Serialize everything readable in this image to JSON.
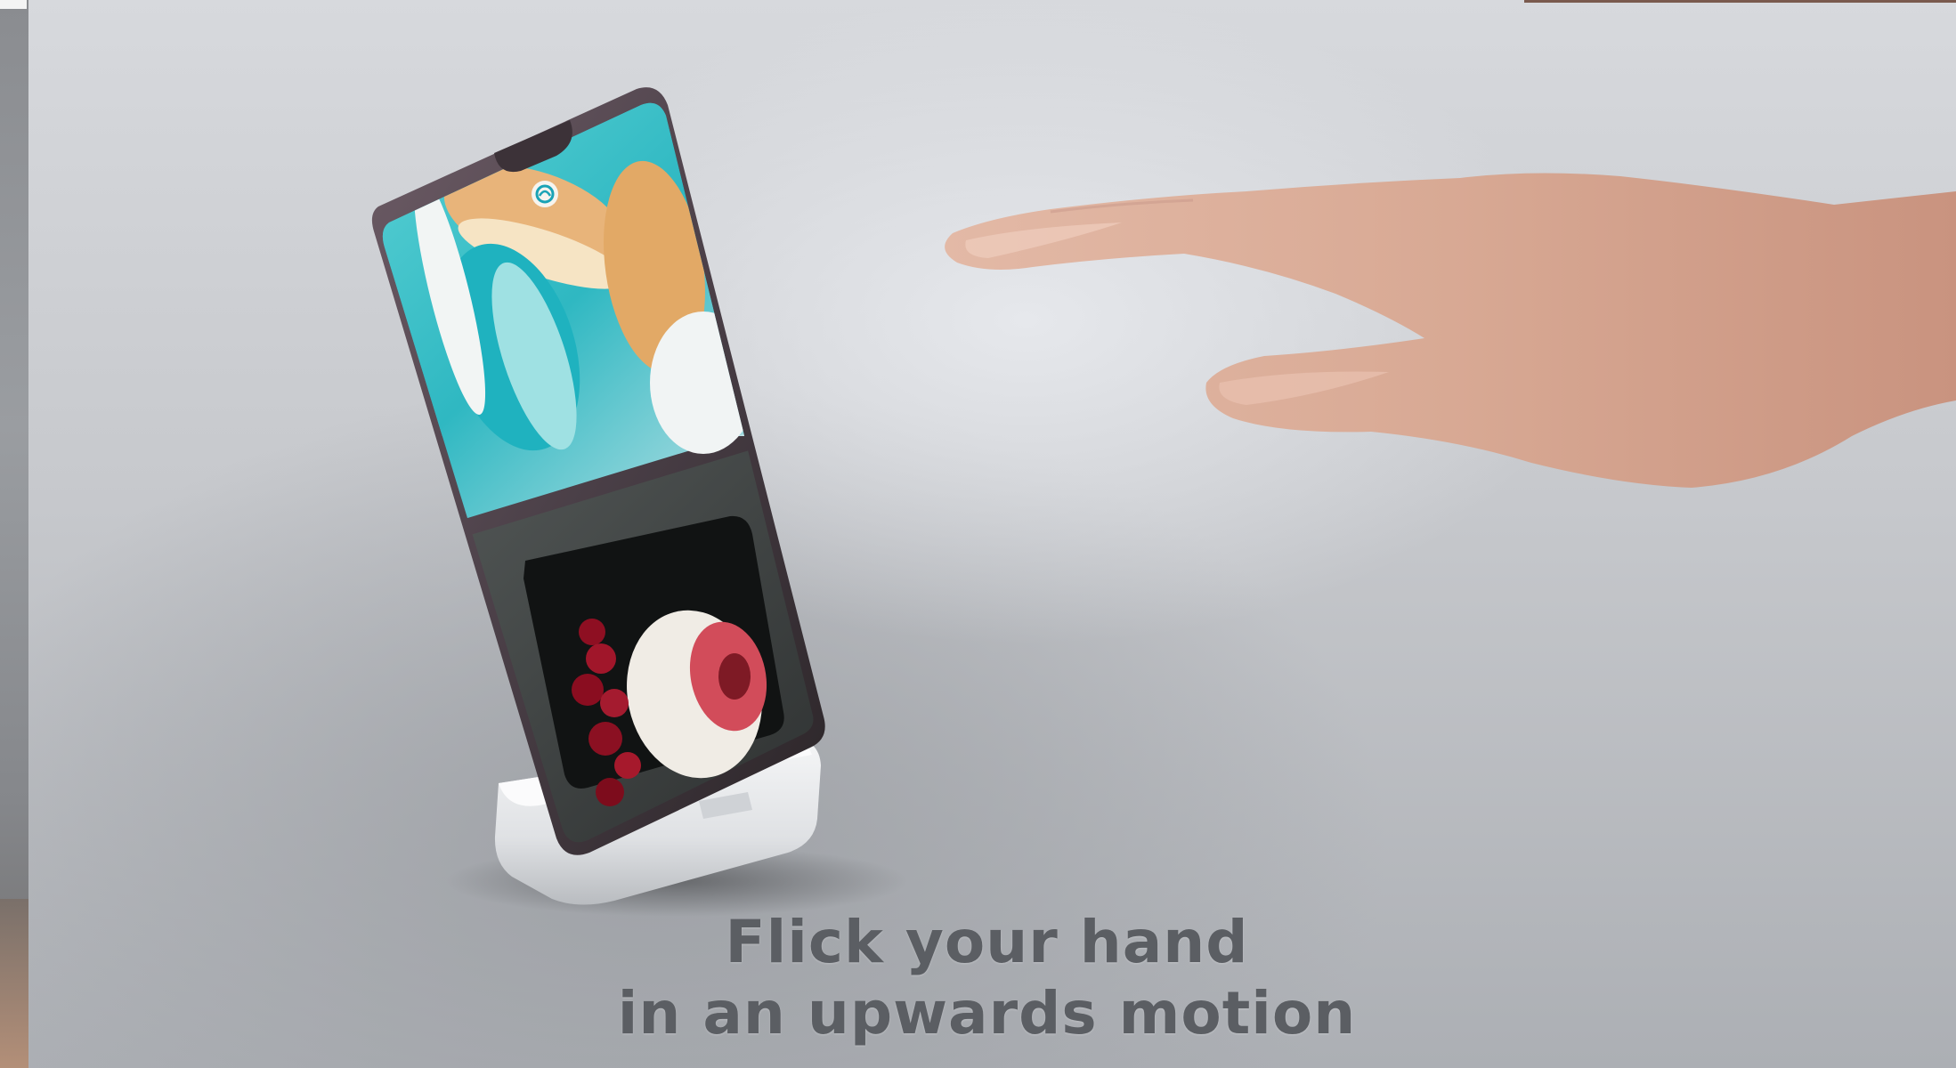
{
  "caption": {
    "line1": "Flick your hand",
    "line2": "in an upwards motion"
  },
  "colors": {
    "caption_text": "#5b5e63",
    "background": "#d7d9dd",
    "phone_frame": "#5e4f58",
    "stand": "#e9eaec"
  },
  "icons": {
    "screen_badge": "air-gesture-hand-icon"
  }
}
